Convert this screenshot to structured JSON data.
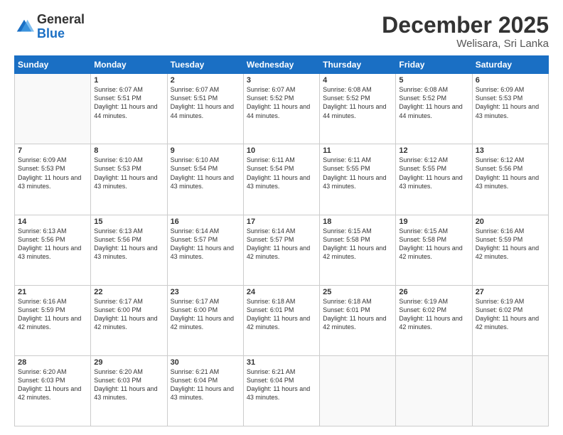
{
  "logo": {
    "general": "General",
    "blue": "Blue"
  },
  "header": {
    "month": "December 2025",
    "location": "Welisara, Sri Lanka"
  },
  "weekdays": [
    "Sunday",
    "Monday",
    "Tuesday",
    "Wednesday",
    "Thursday",
    "Friday",
    "Saturday"
  ],
  "rows": [
    [
      {
        "day": "",
        "sunrise": "",
        "sunset": "",
        "daylight": ""
      },
      {
        "day": "1",
        "sunrise": "6:07 AM",
        "sunset": "5:51 PM",
        "daylight": "11 hours and 44 minutes."
      },
      {
        "day": "2",
        "sunrise": "6:07 AM",
        "sunset": "5:51 PM",
        "daylight": "11 hours and 44 minutes."
      },
      {
        "day": "3",
        "sunrise": "6:07 AM",
        "sunset": "5:52 PM",
        "daylight": "11 hours and 44 minutes."
      },
      {
        "day": "4",
        "sunrise": "6:08 AM",
        "sunset": "5:52 PM",
        "daylight": "11 hours and 44 minutes."
      },
      {
        "day": "5",
        "sunrise": "6:08 AM",
        "sunset": "5:52 PM",
        "daylight": "11 hours and 44 minutes."
      },
      {
        "day": "6",
        "sunrise": "6:09 AM",
        "sunset": "5:53 PM",
        "daylight": "11 hours and 43 minutes."
      }
    ],
    [
      {
        "day": "7",
        "sunrise": "6:09 AM",
        "sunset": "5:53 PM",
        "daylight": "11 hours and 43 minutes."
      },
      {
        "day": "8",
        "sunrise": "6:10 AM",
        "sunset": "5:53 PM",
        "daylight": "11 hours and 43 minutes."
      },
      {
        "day": "9",
        "sunrise": "6:10 AM",
        "sunset": "5:54 PM",
        "daylight": "11 hours and 43 minutes."
      },
      {
        "day": "10",
        "sunrise": "6:11 AM",
        "sunset": "5:54 PM",
        "daylight": "11 hours and 43 minutes."
      },
      {
        "day": "11",
        "sunrise": "6:11 AM",
        "sunset": "5:55 PM",
        "daylight": "11 hours and 43 minutes."
      },
      {
        "day": "12",
        "sunrise": "6:12 AM",
        "sunset": "5:55 PM",
        "daylight": "11 hours and 43 minutes."
      },
      {
        "day": "13",
        "sunrise": "6:12 AM",
        "sunset": "5:56 PM",
        "daylight": "11 hours and 43 minutes."
      }
    ],
    [
      {
        "day": "14",
        "sunrise": "6:13 AM",
        "sunset": "5:56 PM",
        "daylight": "11 hours and 43 minutes."
      },
      {
        "day": "15",
        "sunrise": "6:13 AM",
        "sunset": "5:56 PM",
        "daylight": "11 hours and 43 minutes."
      },
      {
        "day": "16",
        "sunrise": "6:14 AM",
        "sunset": "5:57 PM",
        "daylight": "11 hours and 43 minutes."
      },
      {
        "day": "17",
        "sunrise": "6:14 AM",
        "sunset": "5:57 PM",
        "daylight": "11 hours and 42 minutes."
      },
      {
        "day": "18",
        "sunrise": "6:15 AM",
        "sunset": "5:58 PM",
        "daylight": "11 hours and 42 minutes."
      },
      {
        "day": "19",
        "sunrise": "6:15 AM",
        "sunset": "5:58 PM",
        "daylight": "11 hours and 42 minutes."
      },
      {
        "day": "20",
        "sunrise": "6:16 AM",
        "sunset": "5:59 PM",
        "daylight": "11 hours and 42 minutes."
      }
    ],
    [
      {
        "day": "21",
        "sunrise": "6:16 AM",
        "sunset": "5:59 PM",
        "daylight": "11 hours and 42 minutes."
      },
      {
        "day": "22",
        "sunrise": "6:17 AM",
        "sunset": "6:00 PM",
        "daylight": "11 hours and 42 minutes."
      },
      {
        "day": "23",
        "sunrise": "6:17 AM",
        "sunset": "6:00 PM",
        "daylight": "11 hours and 42 minutes."
      },
      {
        "day": "24",
        "sunrise": "6:18 AM",
        "sunset": "6:01 PM",
        "daylight": "11 hours and 42 minutes."
      },
      {
        "day": "25",
        "sunrise": "6:18 AM",
        "sunset": "6:01 PM",
        "daylight": "11 hours and 42 minutes."
      },
      {
        "day": "26",
        "sunrise": "6:19 AM",
        "sunset": "6:02 PM",
        "daylight": "11 hours and 42 minutes."
      },
      {
        "day": "27",
        "sunrise": "6:19 AM",
        "sunset": "6:02 PM",
        "daylight": "11 hours and 42 minutes."
      }
    ],
    [
      {
        "day": "28",
        "sunrise": "6:20 AM",
        "sunset": "6:03 PM",
        "daylight": "11 hours and 42 minutes."
      },
      {
        "day": "29",
        "sunrise": "6:20 AM",
        "sunset": "6:03 PM",
        "daylight": "11 hours and 43 minutes."
      },
      {
        "day": "30",
        "sunrise": "6:21 AM",
        "sunset": "6:04 PM",
        "daylight": "11 hours and 43 minutes."
      },
      {
        "day": "31",
        "sunrise": "6:21 AM",
        "sunset": "6:04 PM",
        "daylight": "11 hours and 43 minutes."
      },
      {
        "day": "",
        "sunrise": "",
        "sunset": "",
        "daylight": ""
      },
      {
        "day": "",
        "sunrise": "",
        "sunset": "",
        "daylight": ""
      },
      {
        "day": "",
        "sunrise": "",
        "sunset": "",
        "daylight": ""
      }
    ]
  ],
  "labels": {
    "sunrise_prefix": "Sunrise: ",
    "sunset_prefix": "Sunset: ",
    "daylight_prefix": "Daylight: "
  }
}
